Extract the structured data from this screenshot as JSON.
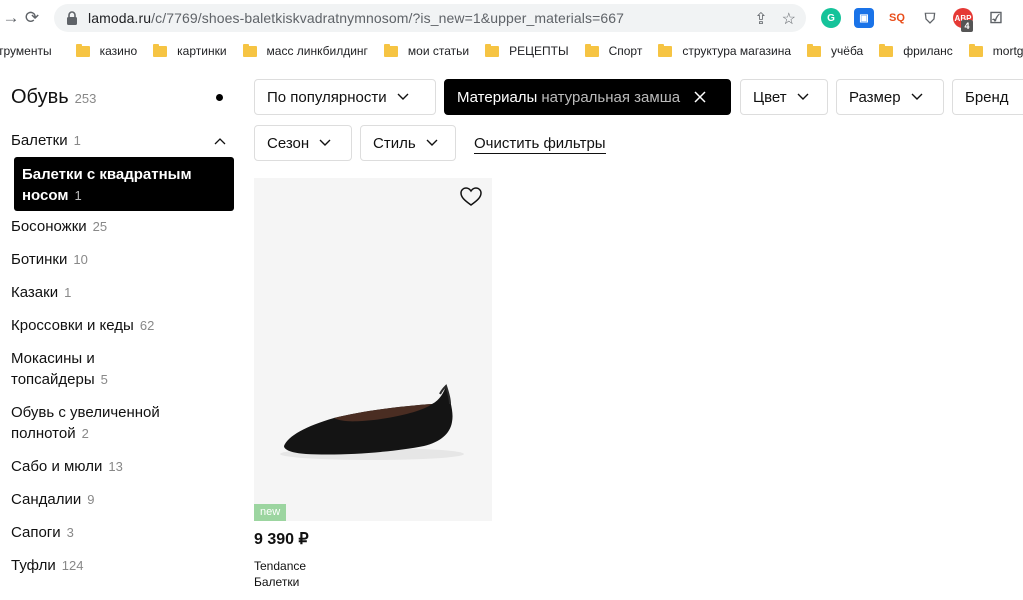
{
  "browser": {
    "url_host": "lamoda.ru",
    "url_path": "/c/7769/shoes-baletkiskvadratnymnosom/?is_new=1&upper_materials=667",
    "extension_badge": "4",
    "bookmarks": [
      "трументы",
      "казино",
      "картинки",
      "масс линкбилдинг",
      "мои статьи",
      "РЕЦЕПТЫ",
      "Спорт",
      "структура магазина",
      "учёба",
      "фриланс",
      "mortgage"
    ]
  },
  "sidebar": {
    "title": "Обувь",
    "title_count": "253",
    "selected_parent": {
      "label": "Балетки",
      "count": "1"
    },
    "selected_sub": {
      "label_line1": "Балетки с квадратным",
      "label_line2": "носом",
      "count": "1"
    },
    "items": [
      {
        "label": "Босоножки",
        "count": "25"
      },
      {
        "label": "Ботинки",
        "count": "10"
      },
      {
        "label": "Казаки",
        "count": "1"
      },
      {
        "label": "Кроссовки и кеды",
        "count": "62"
      },
      {
        "label_line1": "Мокасины и",
        "label_line2": "топсайдеры",
        "count": "5"
      },
      {
        "label_line1": "Обувь с увеличенной",
        "label_line2": "полнотой",
        "count": "2"
      },
      {
        "label": "Сабо и мюли",
        "count": "13"
      },
      {
        "label": "Сандалии",
        "count": "9"
      },
      {
        "label": "Сапоги",
        "count": "3"
      },
      {
        "label": "Туфли",
        "count": "124"
      }
    ]
  },
  "filters": {
    "sort": "По популярности",
    "material_label": "Материалы",
    "material_value": "натуральная замша",
    "color": "Цвет",
    "size": "Размер",
    "brand": "Бренд",
    "season": "Сезон",
    "style": "Стиль",
    "clear": "Очистить фильтры"
  },
  "product": {
    "badge": "new",
    "price": "9 390 ₽",
    "brand": "Tendance",
    "type": "Балетки"
  },
  "colors": {
    "accent_dark": "#000000",
    "new_badge": "#9cd5a0"
  }
}
